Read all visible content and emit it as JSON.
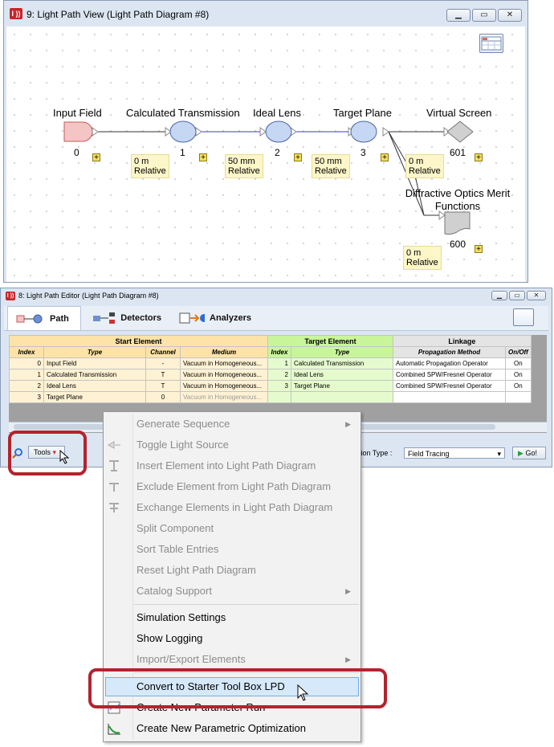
{
  "top_window": {
    "title": "9: Light Path View (Light Path Diagram #8)",
    "app_icon_text": "I ))",
    "nodes": [
      {
        "label": "Input Field",
        "index": "0"
      },
      {
        "label": "Calculated Transmission",
        "index": "1"
      },
      {
        "label": "Ideal Lens",
        "index": "2"
      },
      {
        "label": "Target Plane",
        "index": "3"
      },
      {
        "label": "Virtual Screen",
        "index": "601"
      },
      {
        "label": "Diffractive Optics Merit Functions",
        "index": "600"
      }
    ],
    "notes": [
      {
        "l1": "0 m",
        "l2": "Relative"
      },
      {
        "l1": "50 mm",
        "l2": "Relative"
      },
      {
        "l1": "50 mm",
        "l2": "Relative"
      },
      {
        "l1": "0 m",
        "l2": "Relative"
      },
      {
        "l1": "0 m",
        "l2": "Relative"
      }
    ],
    "plus_glyph": "+"
  },
  "editor_window": {
    "title": "8: Light Path Editor (Light Path Diagram #8)",
    "tabs": [
      {
        "label": "Path",
        "icon": "path-icon"
      },
      {
        "label": "Detectors",
        "icon": "detectors-icon"
      },
      {
        "label": "Analyzers",
        "icon": "analyzers-icon"
      }
    ],
    "group_headers": {
      "start": "Start Element",
      "target": "Target Element",
      "linkage": "Linkage"
    },
    "sub_headers": {
      "s_index": "Index",
      "s_type": "Type",
      "s_channel": "Channel",
      "s_medium": "Medium",
      "t_index": "Index",
      "t_type": "Type",
      "l_method": "Propagation Method",
      "l_onoff": "On/Off"
    },
    "rows": [
      {
        "s_index": "0",
        "s_type": "Input Field",
        "channel": "-",
        "medium": "Vacuum in Homogeneous...",
        "t_index": "1",
        "t_type": "Calculated Transmission",
        "method": "Automatic Propagation Operator",
        "onoff": "On"
      },
      {
        "s_index": "1",
        "s_type": "Calculated Transmission",
        "channel": "T",
        "medium": "Vacuum in Homogeneous...",
        "t_index": "2",
        "t_type": "Ideal Lens",
        "method": "Combined SPW/Fresnel Operator",
        "onoff": "On"
      },
      {
        "s_index": "2",
        "s_type": "Ideal Lens",
        "channel": "T",
        "medium": "Vacuum in Homogeneous...",
        "t_index": "3",
        "t_type": "Target Plane",
        "method": "Combined SPW/Fresnel Operator",
        "onoff": "On"
      },
      {
        "s_index": "3",
        "s_type": "Target Plane",
        "channel": "0",
        "medium": "Vacuum in Homogeneous...",
        "t_index": "",
        "t_type": "",
        "method": "",
        "onoff": ""
      }
    ],
    "tools_label": "Tools",
    "simulation_type_label": "ulation Type :",
    "simulation_type_value": "Field Tracing",
    "go_label": "Go!"
  },
  "context_menu": {
    "items": [
      {
        "label": "Generate Sequence",
        "enabled": false,
        "submenu": true
      },
      {
        "label": "Toggle Light Source",
        "enabled": false
      },
      {
        "label": "Insert Element into Light Path Diagram",
        "enabled": false
      },
      {
        "label": "Exclude Element from Light Path Diagram",
        "enabled": false
      },
      {
        "label": "Exchange Elements in Light Path Diagram",
        "enabled": false
      },
      {
        "label": "Split Component",
        "enabled": false
      },
      {
        "label": "Sort Table Entries",
        "enabled": false
      },
      {
        "label": "Reset Light Path Diagram",
        "enabled": false
      },
      {
        "label": "Catalog Support",
        "enabled": false,
        "submenu": true
      },
      {
        "label": "Simulation Settings",
        "enabled": true
      },
      {
        "label": "Show Logging",
        "enabled": true
      },
      {
        "label": "Import/Export Elements",
        "enabled": false,
        "submenu": true
      },
      {
        "label": "Convert to Starter Tool Box LPD",
        "enabled": true,
        "highlighted": true
      },
      {
        "label": "Create New Parameter Run",
        "enabled": true
      },
      {
        "label": "Create New Parametric Optimization",
        "enabled": true
      }
    ],
    "submenu_arrow": "▶"
  },
  "colors": {
    "highlight_red": "#b3232e",
    "start_header": "#fde3a8",
    "target_header": "#c9f59a",
    "node_blue": "#c5d7f3",
    "input_field_pink": "#f4c5c5"
  }
}
